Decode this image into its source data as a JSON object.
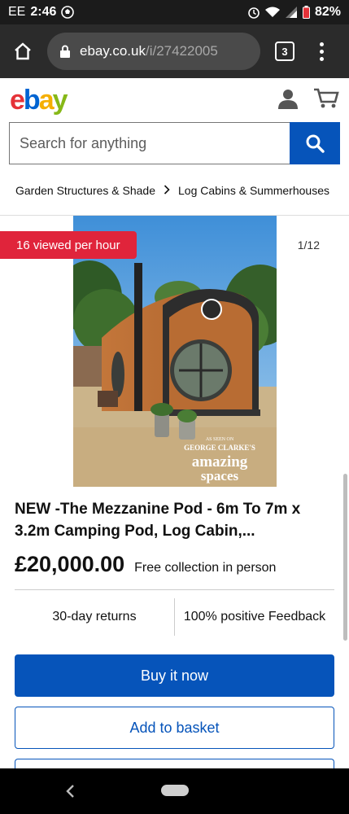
{
  "status_bar": {
    "carrier": "EE",
    "time": "2:46",
    "battery": "82%",
    "icons": [
      "soccer-ball-icon",
      "alarm-icon",
      "wifi-icon",
      "signal-icon",
      "battery-icon"
    ]
  },
  "browser": {
    "url_host": "ebay.co.uk",
    "url_path": "/i/27422005",
    "tab_count": "3"
  },
  "header": {
    "logo": [
      "e",
      "b",
      "a",
      "y"
    ],
    "colors": {
      "e": "#e53238",
      "b": "#0064d2",
      "a": "#f5af02",
      "y": "#86b817",
      "accent": "#0654ba",
      "badge": "#e0243b"
    }
  },
  "search": {
    "placeholder": "Search for anything"
  },
  "breadcrumb": {
    "items": [
      "Garden Structures & Shade",
      "Log Cabins & Summerhouses"
    ]
  },
  "gallery": {
    "badge": "16 viewed per hour",
    "counter": "1/12",
    "image_text_1": "AS SEEN ON",
    "image_text_2": "GEORGE CLARKE'S",
    "image_text_3": "amazing",
    "image_text_4": "spaces"
  },
  "listing": {
    "title": "NEW -The Mezzanine Pod - 6m To 7m x 3.2m Camping Pod, Log Cabin,...",
    "price": "£20,000.00",
    "shipping": "Free collection in person",
    "feature_1": "30-day returns",
    "feature_2": "100% positive Feedback",
    "buy_label": "Buy it now",
    "basket_label": "Add to basket"
  }
}
